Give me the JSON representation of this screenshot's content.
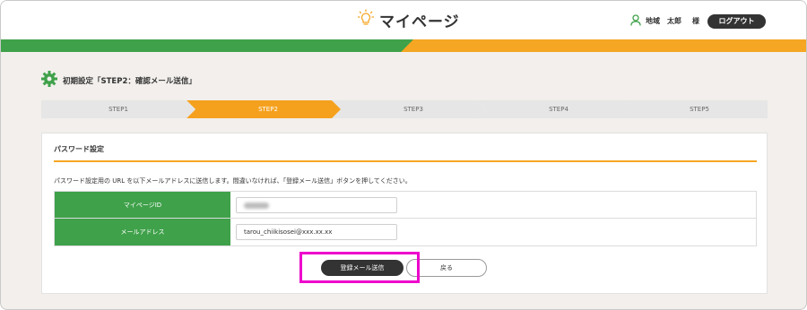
{
  "header": {
    "logo_text": "マイページ",
    "user_name": "地域　太郎",
    "user_suffix": "様",
    "logout_label": "ログアウト"
  },
  "page": {
    "title": "初期設定「STEP2：確認メール送信」"
  },
  "steps": [
    {
      "label": "STEP1",
      "active": false
    },
    {
      "label": "STEP2",
      "active": true
    },
    {
      "label": "STEP3",
      "active": false
    },
    {
      "label": "STEP4",
      "active": false
    },
    {
      "label": "STEP5",
      "active": false
    }
  ],
  "card": {
    "title": "パスワード設定",
    "description": "パスワード設定用の URL を以下メールアドレスに送信します。間違いなければ、「登録メール送信」ボタンを押してください。"
  },
  "form": {
    "rows": [
      {
        "label": "マイページID",
        "value": ""
      },
      {
        "label": "メールアドレス",
        "value": "tarou_chiikisosei@xxx.xx.xx"
      }
    ]
  },
  "buttons": {
    "register_label": "登録メール送信",
    "back_label": "戻る"
  },
  "colors": {
    "green": "#3fa14a",
    "orange": "#f5a623",
    "highlight": "#ee00cc",
    "dark": "#333333"
  },
  "icons": {
    "logo": "lightbulb-icon",
    "user": "user-icon",
    "settings": "gear-icon"
  }
}
